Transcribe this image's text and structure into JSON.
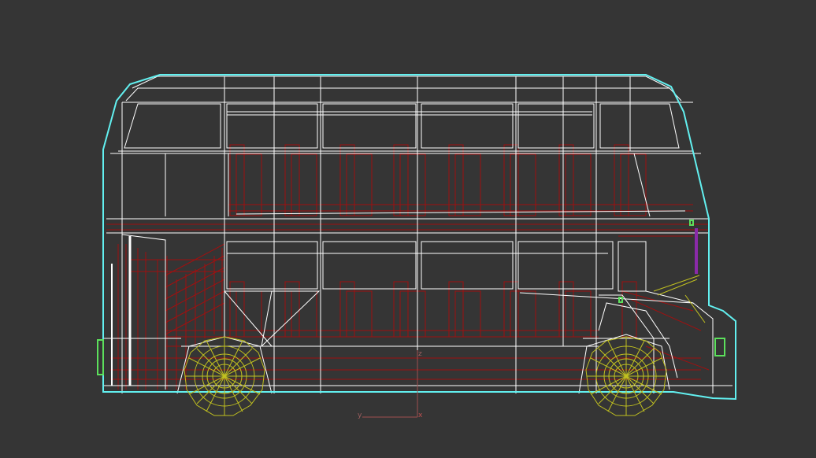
{
  "viewport": {
    "background_color": "#353535",
    "selection_color": "#62f0f0",
    "body_wire_color": "#ffffff",
    "interior_wire_color": "#a01010",
    "wheel_wire_color": "#c0c020",
    "light_color": "#5ce05c",
    "detail_color": "#8a2aa8",
    "gizmo": {
      "y_label": "y",
      "z_label": "z",
      "x_label": "x"
    }
  }
}
